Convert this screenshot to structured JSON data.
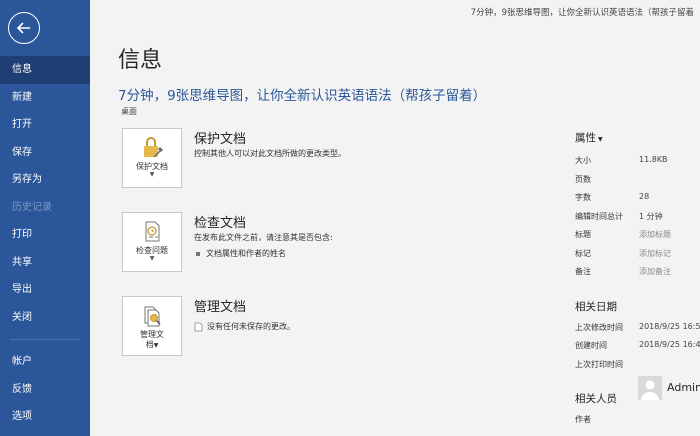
{
  "window": {
    "doc_title": "7分钟，9张思维导图，让你全新认识英语语法（帮孩子留着"
  },
  "sidebar": {
    "items": [
      {
        "label": "信息",
        "active": true
      },
      {
        "label": "新建"
      },
      {
        "label": "打开"
      },
      {
        "label": "保存"
      },
      {
        "label": "另存为"
      },
      {
        "label": "历史记录",
        "disabled": true
      },
      {
        "label": "打印"
      },
      {
        "label": "共享"
      },
      {
        "label": "导出"
      },
      {
        "label": "关闭"
      }
    ],
    "bottom_items": [
      {
        "label": "帐户"
      },
      {
        "label": "反馈"
      },
      {
        "label": "选项"
      }
    ]
  },
  "main": {
    "title": "信息",
    "doc_name": "7分钟，9张思维导图，让你全新认识英语语法（帮孩子留着）",
    "doc_path": "桌面",
    "sections": {
      "protect": {
        "button_label": "保护文档",
        "title": "保护文档",
        "desc": "控制其他人可以对此文档所做的更改类型。"
      },
      "inspect": {
        "button_label": "检查问题",
        "title": "检查文档",
        "desc": "在发布此文件之前，请注意其是否包含:",
        "bullet": "文档属性和作者的姓名"
      },
      "manage": {
        "button_label_1": "管理文",
        "button_label_2": "档",
        "title": "管理文档",
        "desc": "没有任何未保存的更改。"
      }
    }
  },
  "properties": {
    "heading": "属性",
    "rows": [
      {
        "key": "大小",
        "value": "11.8KB"
      },
      {
        "key": "页数",
        "value": ""
      },
      {
        "key": "字数",
        "value": "28"
      },
      {
        "key": "编辑时间总计",
        "value": "1 分钟"
      },
      {
        "key": "标题",
        "value": "添加标题",
        "placeholder": true
      },
      {
        "key": "标记",
        "value": "添加标记",
        "placeholder": true
      },
      {
        "key": "备注",
        "value": "添加备注",
        "placeholder": true
      }
    ],
    "dates_heading": "相关日期",
    "dates": [
      {
        "key": "上次修改时间",
        "value": "2018/9/25 16:5"
      },
      {
        "key": "创建时间",
        "value": "2018/9/25 16:4"
      },
      {
        "key": "上次打印时间",
        "value": ""
      }
    ],
    "people_heading": "相关人员",
    "author_key": "作者",
    "author_name": "Admin"
  },
  "colors": {
    "sidebar": "#2b579a",
    "sidebar_active": "#1f3f74",
    "accent_text": "#2b579a"
  }
}
